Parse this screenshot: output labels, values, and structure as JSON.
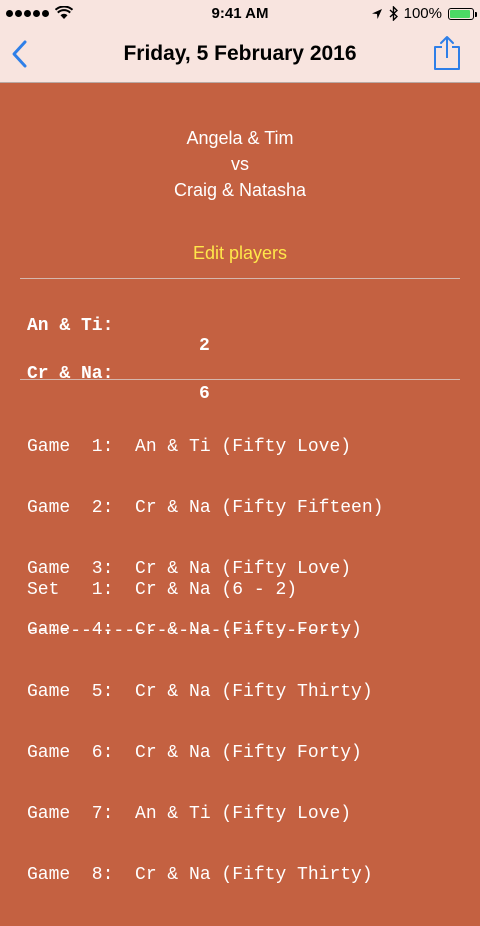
{
  "status_bar": {
    "time": "9:41 AM",
    "battery_percent": "100%",
    "battery_level": 1.0,
    "signal_icon": "signal-dots-icon",
    "wifi_icon": "wifi-icon",
    "location_icon": "location-arrow-icon",
    "bluetooth_icon": "bluetooth-icon"
  },
  "nav": {
    "title": "Friday, 5 February 2016",
    "back_icon": "chevron-left-icon",
    "share_icon": "share-icon",
    "accent_color": "#2f7fe8"
  },
  "matchup": {
    "team1": "Angela & Tim",
    "versus": "vs",
    "team2": "Craig & Natasha"
  },
  "edit_players_label": "Edit players",
  "scores": [
    {
      "name": "An & Ti:",
      "value": "2"
    },
    {
      "name": "Cr & Na:",
      "value": "6"
    }
  ],
  "games": [
    "Game  1:  An & Ti (Fifty Love)",
    "Game  2:  Cr & Na (Fifty Fifteen)",
    "Game  3:  Cr & Na (Fifty Love)",
    "Game  4:  Cr & Na (Fifty Forty)",
    "Game  5:  Cr & Na (Fifty Thirty)",
    "Game  6:  Cr & Na (Fifty Forty)",
    "Game  7:  An & Ti (Fifty Love)",
    "Game  8:  Cr & Na (Fifty Thirty)"
  ],
  "set_summary": "Set   1:  Cr & Na (6 - 2)",
  "separator": "------------------------------",
  "colors": {
    "background": "#c46141",
    "bar_background": "#f8e4df",
    "edit_players": "#ffe74a",
    "text": "#ffffff"
  }
}
